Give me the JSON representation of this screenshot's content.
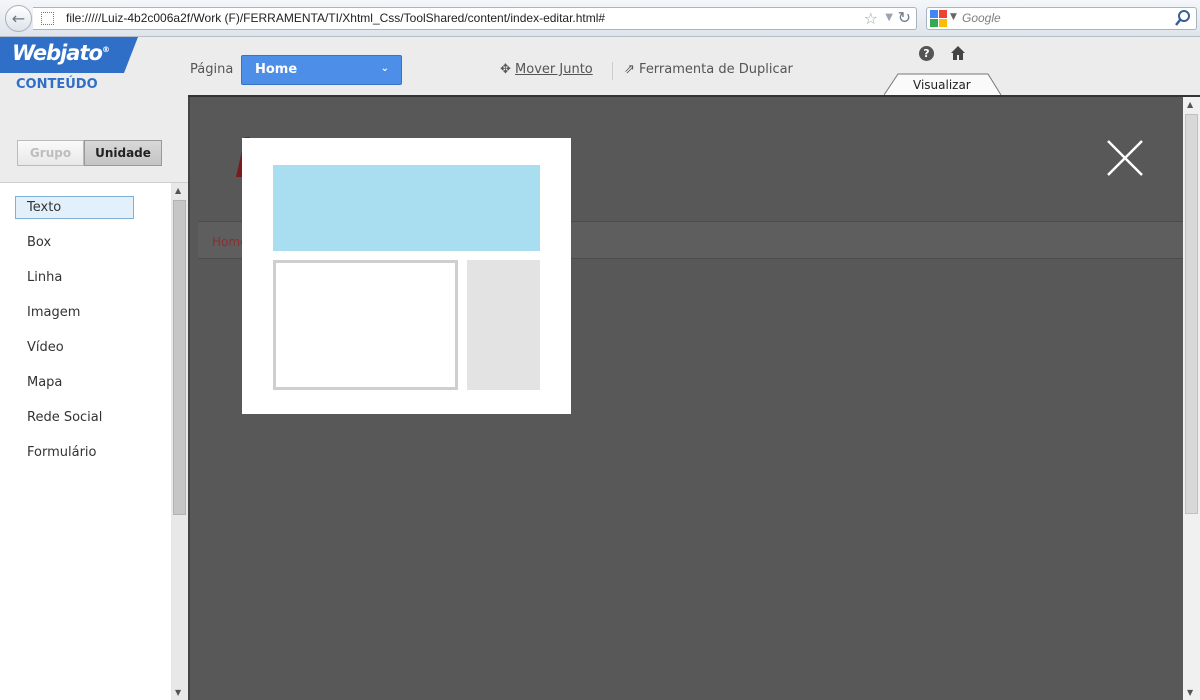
{
  "browser": {
    "url": "file://///Luiz-4b2c006a2f/Work  (F)/FERRAMENTA/TI/Xhtml_Css/ToolShared/content/index-editar.html#",
    "search_placeholder": "Google"
  },
  "app": {
    "logo": "Webjato",
    "section": "CONTEÚDO"
  },
  "page_select": {
    "label": "Página",
    "value": "Home"
  },
  "tools": {
    "move": "Mover Junto",
    "duplicate": "Ferramenta de Duplicar"
  },
  "view_tab": "Visualizar",
  "mode_toggle": {
    "group": "Grupo",
    "unit": "Unidade",
    "active": "unit"
  },
  "components": [
    "Texto",
    "Box",
    "Linha",
    "Imagem",
    "Vídeo",
    "Mapa",
    "Rede Social",
    "Formulário"
  ],
  "active_component": "Texto",
  "workspace": {
    "nav_home": "Home"
  },
  "colors": {
    "brand_blue": "#2f6fc7",
    "select_blue": "#4d8ee8",
    "workspace_bg": "#585858",
    "template_header": "#a9def0",
    "template_side": "#e3e3e3"
  },
  "icons": [
    "back-icon",
    "page-icon",
    "star-icon",
    "reload-icon",
    "google-icon",
    "search-icon",
    "move-icon",
    "duplicate-icon",
    "help-icon",
    "home-icon",
    "close-icon"
  ]
}
